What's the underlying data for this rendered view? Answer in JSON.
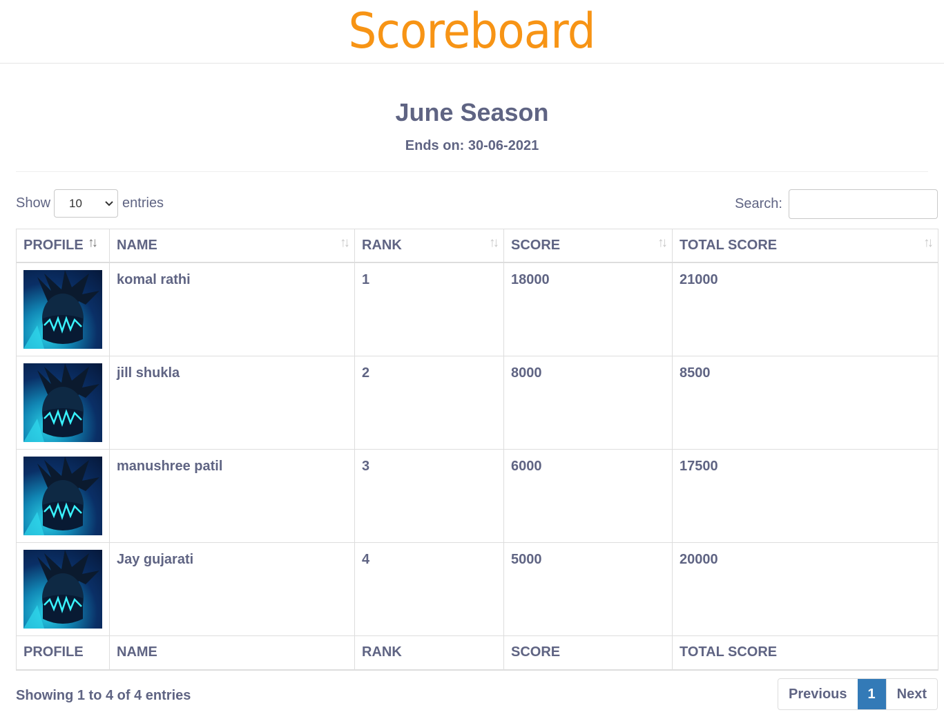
{
  "header": {
    "brand": "Scoreboard"
  },
  "season": {
    "title": "June Season",
    "ends_on": "Ends on: 30-06-2021"
  },
  "controls": {
    "show_label": "Show",
    "page_length": "10",
    "entries_label": "entries",
    "search_label": "Search:",
    "search_value": ""
  },
  "table": {
    "columns": [
      "PROFILE",
      "NAME",
      "RANK",
      "SCORE",
      "TOTAL SCORE"
    ],
    "rows": [
      {
        "name": "komal rathi",
        "rank": "1",
        "score": "18000",
        "total_score": "21000"
      },
      {
        "name": "jill shukla",
        "rank": "2",
        "score": "8000",
        "total_score": "8500"
      },
      {
        "name": "manushree patil",
        "rank": "3",
        "score": "6000",
        "total_score": "17500"
      },
      {
        "name": "Jay gujarati",
        "rank": "4",
        "score": "5000",
        "total_score": "20000"
      }
    ]
  },
  "footer": {
    "info": "Showing 1 to 4 of 4 entries",
    "previous_label": "Previous",
    "current_page": "1",
    "next_label": "Next"
  },
  "icons": {
    "sort": "sort-arrows-icon",
    "dropdown": "chevron-down-icon"
  },
  "colors": {
    "brand": "#f79415",
    "text": "#5f6483",
    "active_page": "#337ab7"
  }
}
